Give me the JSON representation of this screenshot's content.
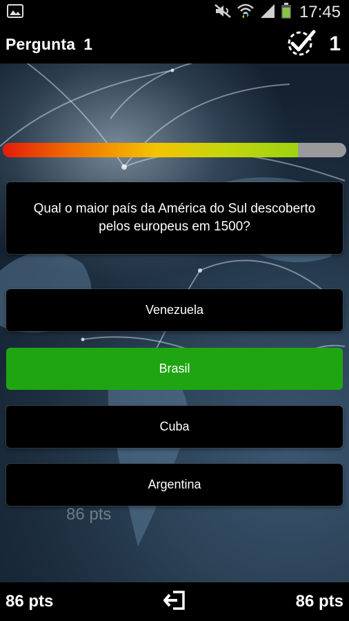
{
  "status_bar": {
    "time": "17:45",
    "icons": [
      "image-icon",
      "mute-icon",
      "wifi-icon",
      "signal-icon",
      "battery-icon"
    ]
  },
  "header": {
    "title": "Pergunta",
    "question_number": "1",
    "correct_count": "1",
    "check_icon": "check-circle-icon"
  },
  "progress": {
    "fraction": 0.86
  },
  "question": {
    "text": "Qual o maior país da América do Sul descoberto pelos europeus em 1500?"
  },
  "answers": [
    {
      "label": "Venezuela",
      "state": "default"
    },
    {
      "label": "Brasil",
      "state": "correct"
    },
    {
      "label": "Cuba",
      "state": "default"
    },
    {
      "label": "Argentina",
      "state": "default"
    }
  ],
  "ghost_score": "86 pts",
  "footer": {
    "left_score": "86 pts",
    "right_score": "86 pts",
    "exit_icon": "exit-icon"
  },
  "colors": {
    "correct": "#1fa512",
    "progress_start": "#e31b0b",
    "progress_end": "#9ed210",
    "progress_track": "#9a9a9a"
  }
}
